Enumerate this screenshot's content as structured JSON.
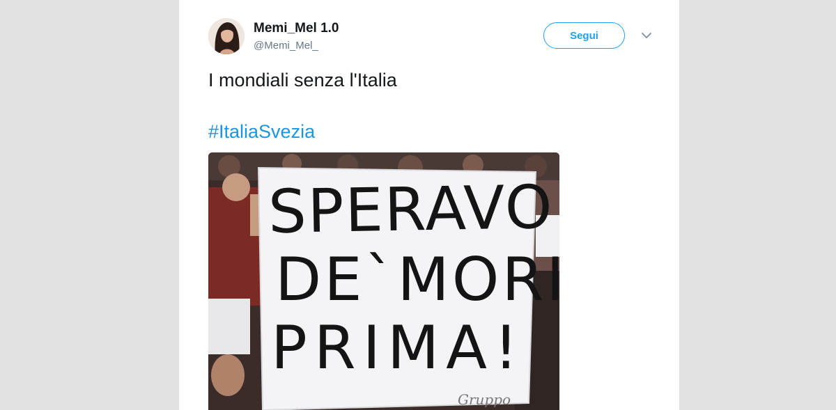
{
  "tweet": {
    "display_name": "Memi_Mel 1.0",
    "handle": "@Memi_Mel_",
    "follow_label": "Segui",
    "text": "I mondiali senza l'Italia",
    "hashtag": "#ItaliaSvezia",
    "media": {
      "banner_lines": [
        "SPERAVO",
        "DE`MORI`",
        "PRIMA!"
      ],
      "signature": "Gruppo"
    }
  },
  "icons": {
    "menu": "chevron-down-icon"
  },
  "colors": {
    "accent": "#1da1f2",
    "hashtag": "#1b95e0",
    "text": "#14171a",
    "secondary": "#657786",
    "background": "#e1e1e1"
  }
}
